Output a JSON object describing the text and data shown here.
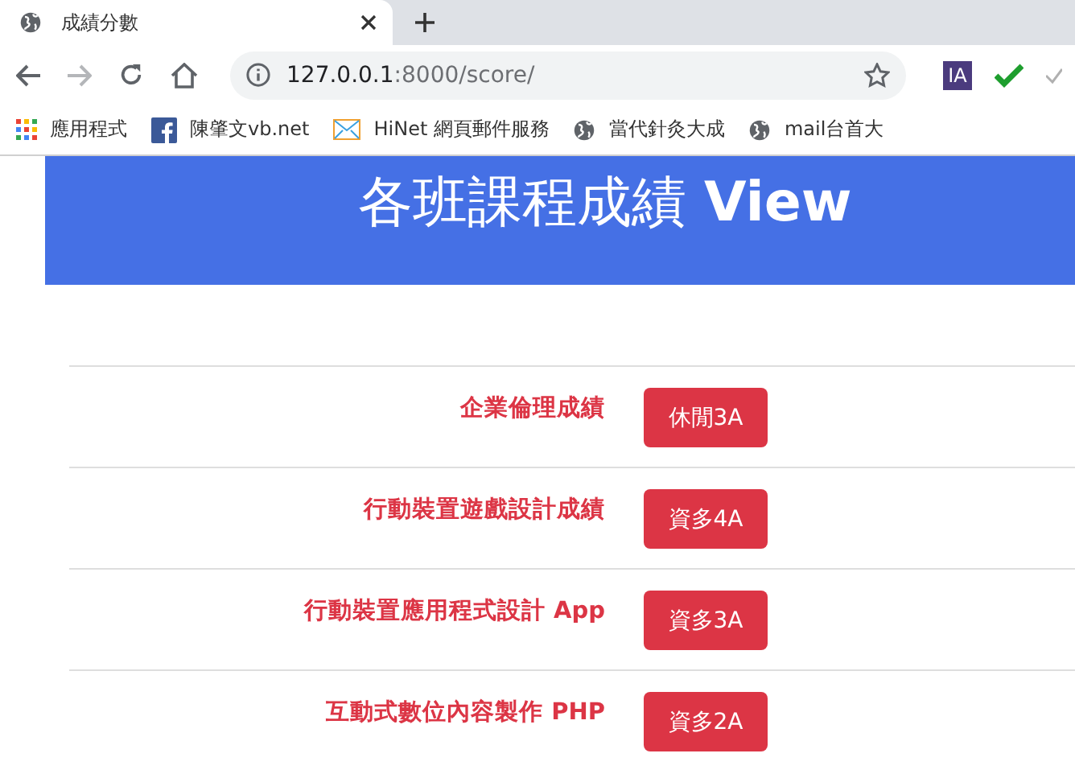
{
  "browser": {
    "tab": {
      "title": "成績分數",
      "selected": true
    },
    "address": {
      "host": "127.0.0.1",
      "path": ":8000/score/"
    },
    "extensions": [
      {
        "kind": "ia",
        "label": "IA"
      },
      {
        "kind": "check"
      },
      {
        "kind": "check-grey"
      }
    ],
    "bookmarks": [
      {
        "kind": "apps",
        "label": "應用程式"
      },
      {
        "kind": "facebook",
        "label": "陳肇文vb.net"
      },
      {
        "kind": "mail",
        "label": "HiNet 網頁郵件服務"
      },
      {
        "kind": "globe",
        "label": "當代針灸大成"
      },
      {
        "kind": "globe",
        "label": "mail台首大"
      }
    ]
  },
  "banner": {
    "title": "各班課程成績",
    "suffix": "View"
  },
  "courses": [
    {
      "name": "企業倫理成績",
      "class": "休閒3A"
    },
    {
      "name": "行動裝置遊戲設計成績",
      "class": "資多4A"
    },
    {
      "name": "行動裝置應用程式設計 App",
      "class": "資多3A"
    },
    {
      "name": "互動式數位內容製作 PHP",
      "class": "資多2A"
    }
  ]
}
